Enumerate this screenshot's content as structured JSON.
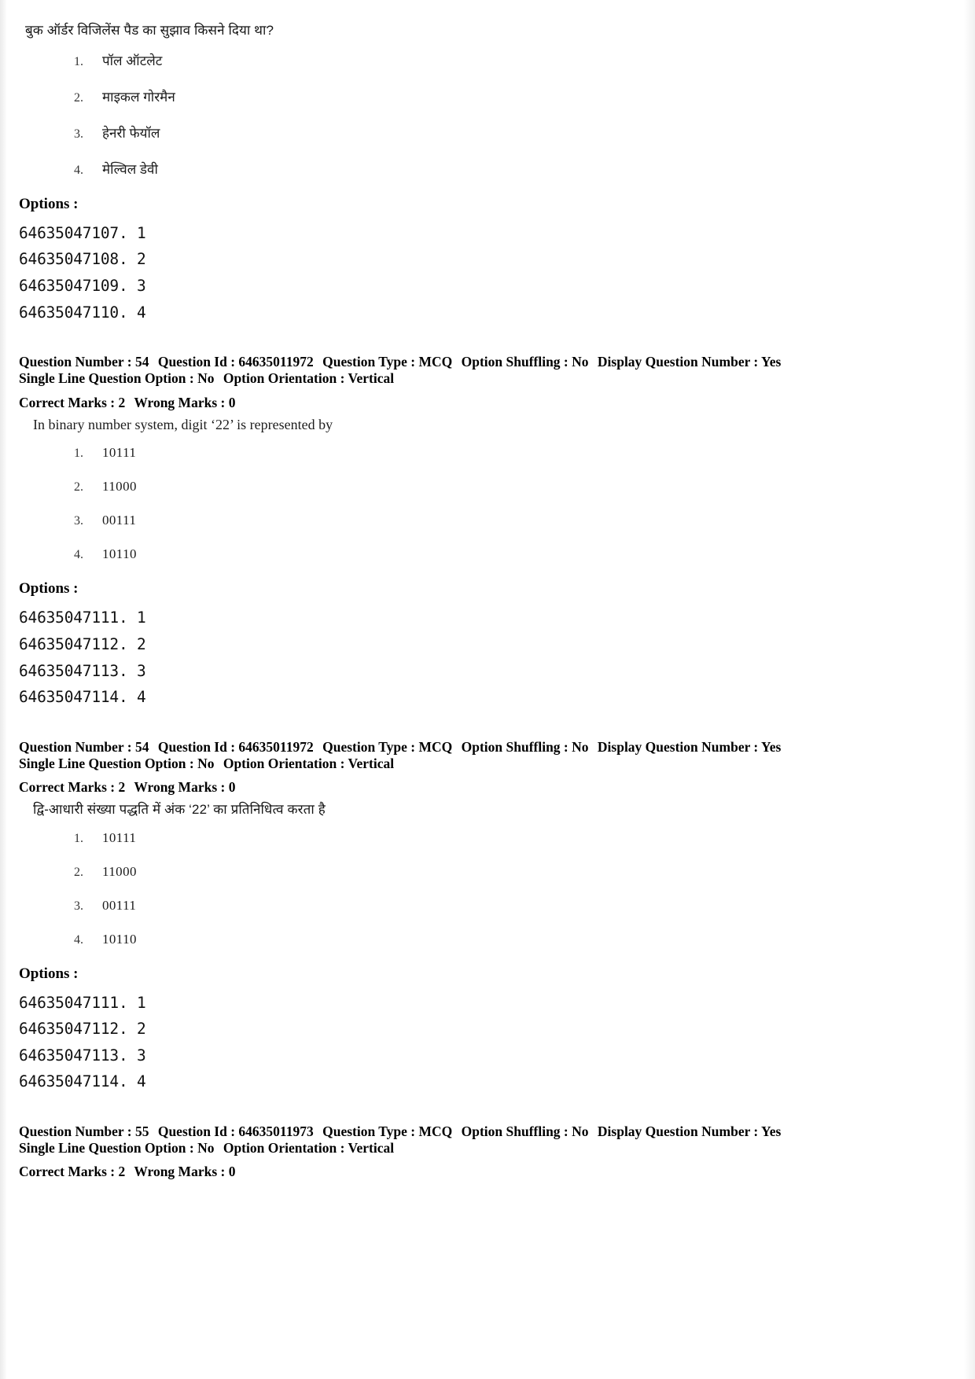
{
  "page": {
    "type": "exam-answer-key-page",
    "language_pairs": "English / Hindi"
  },
  "blocks": [
    {
      "id": "q53-hindi",
      "kind": "question-body",
      "script": "hi",
      "stem": "बुक ऑर्डर विजिलेंस पैड का सुझाव किसने दिया था?",
      "choices": [
        {
          "num": "1.",
          "text": "पॉल ऑटलेट"
        },
        {
          "num": "2.",
          "text": "माइकल गोरमैन"
        },
        {
          "num": "3.",
          "text": "हेनरी फेयॉल"
        },
        {
          "num": "4.",
          "text": "मेल्विल डेवी"
        }
      ],
      "options_label": "Options :",
      "option_ids": [
        "64635047107. 1",
        "64635047108. 2",
        "64635047109. 3",
        "64635047110. 4"
      ]
    },
    {
      "id": "q54-meta-en",
      "kind": "metadata",
      "line1": {
        "question_number_label": "Question Number :",
        "question_number": "54",
        "question_id_label": "Question Id :",
        "question_id": "64635011972",
        "question_type_label": "Question Type :",
        "question_type": "MCQ",
        "option_shuffling_label": "Option Shuffling :",
        "option_shuffling": "No",
        "display_question_number_label": "Display Question Number :",
        "display_question_number": "Yes"
      },
      "line2": {
        "single_line_question_option_label": "Single Line Question Option :",
        "single_line_question_option": "No",
        "option_orientation_label": "Option Orientation :",
        "option_orientation": "Vertical"
      },
      "line3": {
        "correct_marks_label": "Correct Marks :",
        "correct_marks": "2",
        "wrong_marks_label": "Wrong Marks :",
        "wrong_marks": "0"
      }
    },
    {
      "id": "q54-english",
      "kind": "question-body",
      "script": "en",
      "stem": "In binary number system, digit ‘22’ is represented by",
      "choices": [
        {
          "num": "1.",
          "text": "10111"
        },
        {
          "num": "2.",
          "text": "11000"
        },
        {
          "num": "3.",
          "text": "00111"
        },
        {
          "num": "4.",
          "text": "10110"
        }
      ],
      "options_label": "Options :",
      "option_ids": [
        "64635047111. 1",
        "64635047112. 2",
        "64635047113. 3",
        "64635047114. 4"
      ]
    },
    {
      "id": "q54-meta-hi",
      "kind": "metadata",
      "line1": {
        "question_number_label": "Question Number :",
        "question_number": "54",
        "question_id_label": "Question Id :",
        "question_id": "64635011972",
        "question_type_label": "Question Type :",
        "question_type": "MCQ",
        "option_shuffling_label": "Option Shuffling :",
        "option_shuffling": "No",
        "display_question_number_label": "Display Question Number :",
        "display_question_number": "Yes"
      },
      "line2": {
        "single_line_question_option_label": "Single Line Question Option :",
        "single_line_question_option": "No",
        "option_orientation_label": "Option Orientation :",
        "option_orientation": "Vertical"
      },
      "line3": {
        "correct_marks_label": "Correct Marks :",
        "correct_marks": "2",
        "wrong_marks_label": "Wrong Marks :",
        "wrong_marks": "0"
      }
    },
    {
      "id": "q54-hindi",
      "kind": "question-body",
      "script": "hi",
      "stem": "द्वि-आधारी संख्या पद्धति में अंक ‘22’ का प्रतिनिधित्व करता है",
      "choices": [
        {
          "num": "1.",
          "text": "10111"
        },
        {
          "num": "2.",
          "text": "11000"
        },
        {
          "num": "3.",
          "text": "00111"
        },
        {
          "num": "4.",
          "text": "10110"
        }
      ],
      "options_label": "Options :",
      "option_ids": [
        "64635047111. 1",
        "64635047112. 2",
        "64635047113. 3",
        "64635047114. 4"
      ]
    },
    {
      "id": "q55-meta",
      "kind": "metadata",
      "line1": {
        "question_number_label": "Question Number :",
        "question_number": "55",
        "question_id_label": "Question Id :",
        "question_id": "64635011973",
        "question_type_label": "Question Type :",
        "question_type": "MCQ",
        "option_shuffling_label": "Option Shuffling :",
        "option_shuffling": "No",
        "display_question_number_label": "Display Question Number :",
        "display_question_number": "Yes"
      },
      "line2": {
        "single_line_question_option_label": "Single Line Question Option :",
        "single_line_question_option": "No",
        "option_orientation_label": "Option Orientation :",
        "option_orientation": "Vertical"
      },
      "line3": {
        "correct_marks_label": "Correct Marks :",
        "correct_marks": "2",
        "wrong_marks_label": "Wrong Marks :",
        "wrong_marks": "0"
      }
    }
  ]
}
